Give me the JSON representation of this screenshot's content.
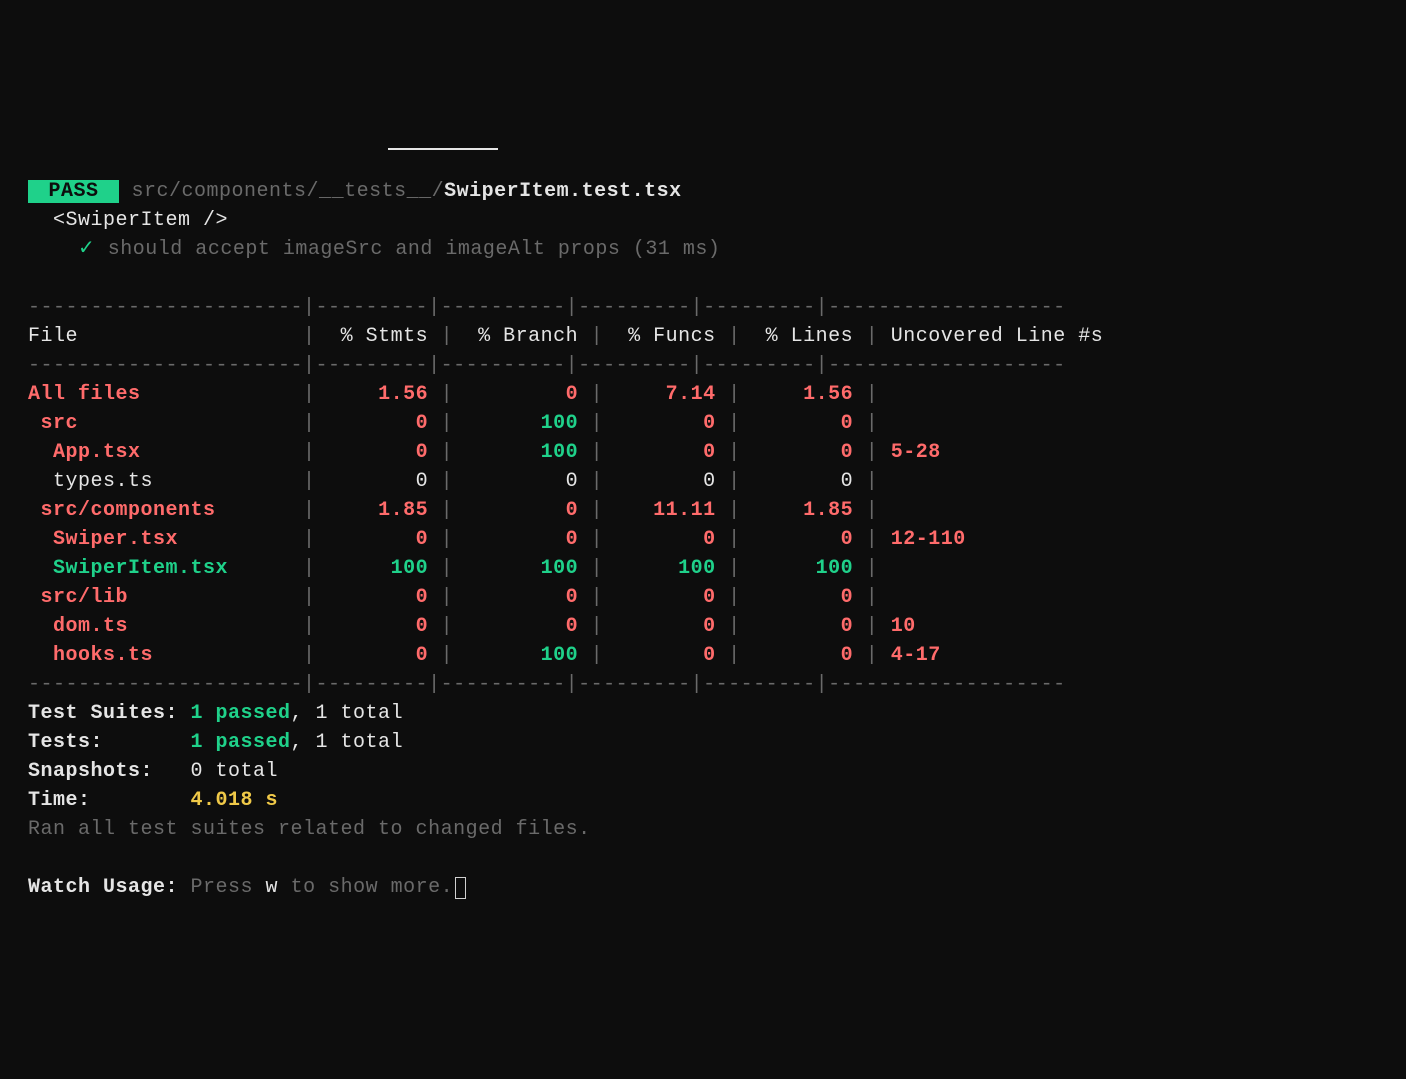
{
  "header": {
    "pass_badge": " PASS ",
    "path_prefix": "src/components/__tests__/",
    "path_file": "SwiperItem.test.tsx",
    "component_line": "  <SwiperItem />",
    "check_mark": "✓",
    "test_name": "should accept imageSrc and imageAlt props (31 ms)"
  },
  "table": {
    "border_top": "----------------------|---------|----------|---------|---------|-------------------",
    "border_mid": "----------------------|---------|----------|---------|---------|-------------------",
    "border_bottom": "----------------------|---------|----------|---------|---------|-------------------",
    "headers": {
      "file": "File",
      "stmts": "% Stmts",
      "branch": "% Branch",
      "funcs": "% Funcs",
      "lines": "% Lines",
      "uncovered": "Uncovered Line #s"
    },
    "rows": [
      {
        "file": "All files",
        "indent": 0,
        "file_cls": "redb",
        "stmts": "1.56",
        "stmts_cls": "redb",
        "branch": "0",
        "branch_cls": "redb",
        "funcs": "7.14",
        "funcs_cls": "redb",
        "lines": "1.56",
        "lines_cls": "redb",
        "uncovered": "",
        "uncov_cls": ""
      },
      {
        "file": "src",
        "indent": 1,
        "file_cls": "redb",
        "stmts": "0",
        "stmts_cls": "redb",
        "branch": "100",
        "branch_cls": "greenb",
        "funcs": "0",
        "funcs_cls": "redb",
        "lines": "0",
        "lines_cls": "redb",
        "uncovered": "",
        "uncov_cls": ""
      },
      {
        "file": "App.tsx",
        "indent": 2,
        "file_cls": "redb",
        "stmts": "0",
        "stmts_cls": "redb",
        "branch": "100",
        "branch_cls": "greenb",
        "funcs": "0",
        "funcs_cls": "redb",
        "lines": "0",
        "lines_cls": "redb",
        "uncovered": "5-28",
        "uncov_cls": "redb"
      },
      {
        "file": "types.ts",
        "indent": 2,
        "file_cls": "white",
        "stmts": "0",
        "stmts_cls": "white",
        "branch": "0",
        "branch_cls": "white",
        "funcs": "0",
        "funcs_cls": "white",
        "lines": "0",
        "lines_cls": "white",
        "uncovered": "",
        "uncov_cls": ""
      },
      {
        "file": "src/components",
        "indent": 1,
        "file_cls": "redb",
        "stmts": "1.85",
        "stmts_cls": "redb",
        "branch": "0",
        "branch_cls": "redb",
        "funcs": "11.11",
        "funcs_cls": "redb",
        "lines": "1.85",
        "lines_cls": "redb",
        "uncovered": "",
        "uncov_cls": ""
      },
      {
        "file": "Swiper.tsx",
        "indent": 2,
        "file_cls": "redb",
        "stmts": "0",
        "stmts_cls": "redb",
        "branch": "0",
        "branch_cls": "redb",
        "funcs": "0",
        "funcs_cls": "redb",
        "lines": "0",
        "lines_cls": "redb",
        "uncovered": "12-110",
        "uncov_cls": "redb"
      },
      {
        "file": "SwiperItem.tsx",
        "indent": 2,
        "file_cls": "greenb",
        "stmts": "100",
        "stmts_cls": "greenb",
        "branch": "100",
        "branch_cls": "greenb",
        "funcs": "100",
        "funcs_cls": "greenb",
        "lines": "100",
        "lines_cls": "greenb",
        "uncovered": "",
        "uncov_cls": ""
      },
      {
        "file": "src/lib",
        "indent": 1,
        "file_cls": "redb",
        "stmts": "0",
        "stmts_cls": "redb",
        "branch": "0",
        "branch_cls": "redb",
        "funcs": "0",
        "funcs_cls": "redb",
        "lines": "0",
        "lines_cls": "redb",
        "uncovered": "",
        "uncov_cls": ""
      },
      {
        "file": "dom.ts",
        "indent": 2,
        "file_cls": "redb",
        "stmts": "0",
        "stmts_cls": "redb",
        "branch": "0",
        "branch_cls": "redb",
        "funcs": "0",
        "funcs_cls": "redb",
        "lines": "0",
        "lines_cls": "redb",
        "uncovered": "10",
        "uncov_cls": "redb"
      },
      {
        "file": "hooks.ts",
        "indent": 2,
        "file_cls": "redb",
        "stmts": "0",
        "stmts_cls": "redb",
        "branch": "100",
        "branch_cls": "greenb",
        "funcs": "0",
        "funcs_cls": "redb",
        "lines": "0",
        "lines_cls": "redb",
        "uncovered": "4-17",
        "uncov_cls": "redb"
      }
    ]
  },
  "summary": {
    "suites_label": "Test Suites: ",
    "suites_passed": "1 passed",
    "suites_total": ", 1 total",
    "tests_label": "Tests:       ",
    "tests_passed": "1 passed",
    "tests_total": ", 1 total",
    "snapshots_label": "Snapshots:   ",
    "snapshots_value": "0 total",
    "time_label": "Time:        ",
    "time_value": "4.018 s",
    "ran_msg": "Ran all test suites related to changed files."
  },
  "watch": {
    "label": "Watch Usage: ",
    "press": "Press ",
    "key": "w",
    "rest": " to show more."
  }
}
